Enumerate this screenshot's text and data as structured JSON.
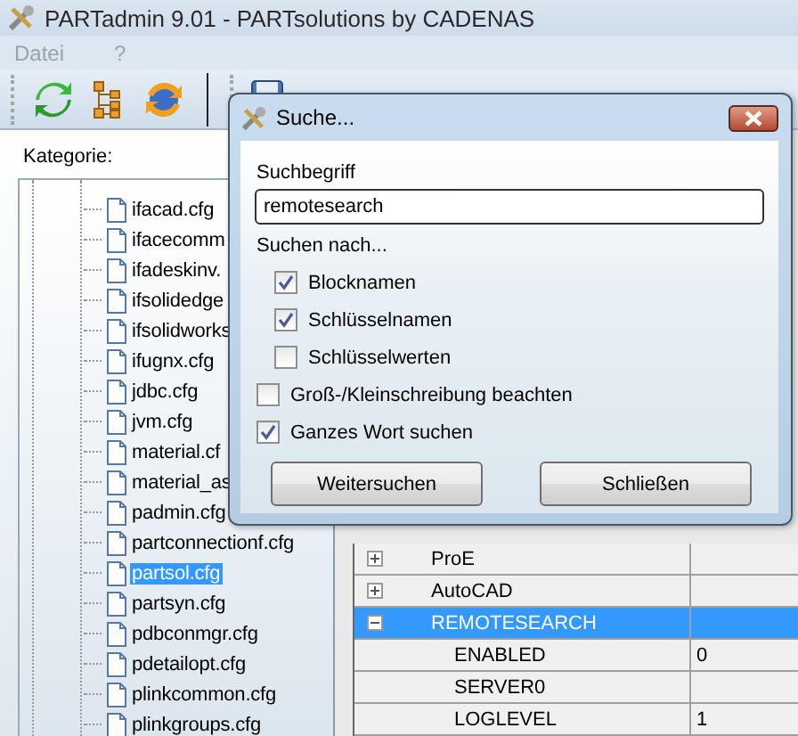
{
  "window": {
    "title": "PARTadmin 9.01 - PARTsolutions by CADENAS"
  },
  "menu": [
    {
      "label": "Datei",
      "disabled": true
    },
    {
      "label": "?",
      "disabled": true
    }
  ],
  "category_label": "Kategorie:",
  "tree": [
    {
      "label": "ifacad.cfg",
      "selected": false
    },
    {
      "label": "ifacecomm",
      "selected": false
    },
    {
      "label": "ifadeskinv.",
      "selected": false
    },
    {
      "label": "ifsolidedge",
      "selected": false
    },
    {
      "label": "ifsolidworks",
      "selected": false
    },
    {
      "label": "ifugnx.cfg",
      "selected": false
    },
    {
      "label": "jdbc.cfg",
      "selected": false
    },
    {
      "label": "jvm.cfg",
      "selected": false
    },
    {
      "label": "material.cf",
      "selected": false
    },
    {
      "label": "material_as",
      "selected": false
    },
    {
      "label": "padmin.cfg",
      "selected": false
    },
    {
      "label": "partconnectionf.cfg",
      "selected": false
    },
    {
      "label": "partsol.cfg",
      "selected": true
    },
    {
      "label": "partsyn.cfg",
      "selected": false
    },
    {
      "label": "pdbconmgr.cfg",
      "selected": false
    },
    {
      "label": "pdetailopt.cfg",
      "selected": false
    },
    {
      "label": "plinkcommon.cfg",
      "selected": false
    },
    {
      "label": "plinkgroups.cfg",
      "selected": false
    }
  ],
  "table": {
    "rows": [
      {
        "kind": "group",
        "name": "ProE",
        "expanded": false,
        "selected": false
      },
      {
        "kind": "group",
        "name": "AutoCAD",
        "expanded": false,
        "selected": false
      },
      {
        "kind": "group",
        "name": "REMOTESEARCH",
        "expanded": true,
        "selected": true
      },
      {
        "kind": "key",
        "name": "ENABLED",
        "value": "0",
        "selected": false
      },
      {
        "kind": "key",
        "name": "SERVER0",
        "selected": false
      },
      {
        "kind": "key",
        "name": "LOGLEVEL",
        "value": "1",
        "selected": false
      }
    ]
  },
  "dialog": {
    "title": "Suche...",
    "search_label": "Suchbegriff",
    "search_value": "remotesearch",
    "search_in_label": "Suchen nach...",
    "search_in": [
      {
        "label": "Blocknamen",
        "checked": true
      },
      {
        "label": "Schlüsselnamen",
        "checked": true
      },
      {
        "label": "Schlüsselwerten",
        "checked": false
      }
    ],
    "options": [
      {
        "label": "Groß-/Kleinschreibung beachten",
        "checked": false
      },
      {
        "label": "Ganzes Wort suchen",
        "checked": true
      }
    ],
    "buttons": [
      {
        "label": "Weitersuchen"
      },
      {
        "label": "Schließen"
      }
    ]
  }
}
